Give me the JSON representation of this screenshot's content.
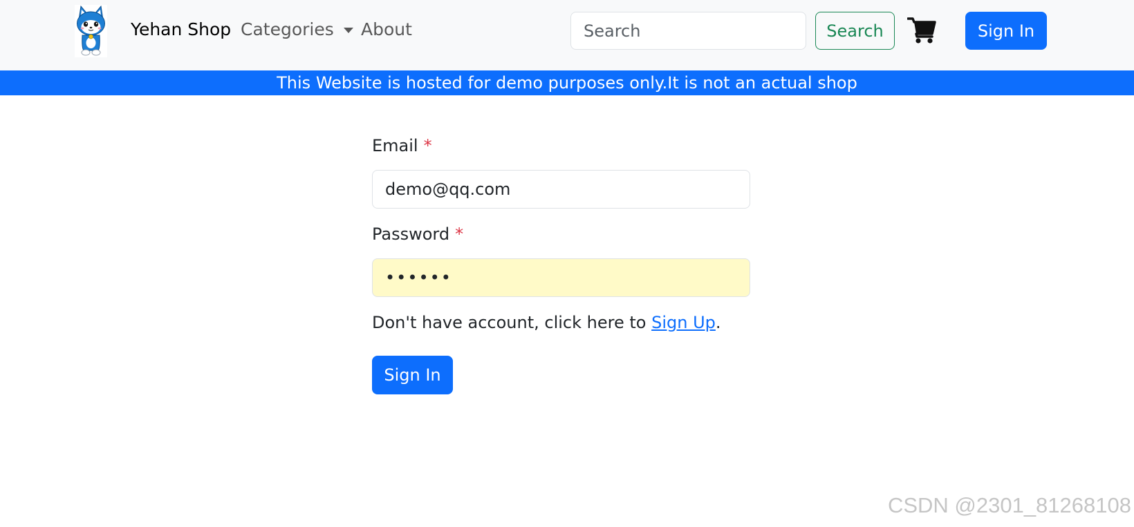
{
  "navbar": {
    "brand": "Yehan Shop",
    "categories_label": "Categories",
    "about_label": "About",
    "search_placeholder": "Search",
    "search_button": "Search",
    "signin_button": "Sign In",
    "cart_icon": "shopping-cart-icon",
    "logo_icon": "cat-mascot-logo"
  },
  "banner": {
    "text": "This Website is hosted for demo purposes only.It is not an actual shop"
  },
  "form": {
    "email_label": "Email",
    "email_required": "*",
    "email_value": "demo@qq.com",
    "password_label": "Password",
    "password_required": "*",
    "password_value": "••••••",
    "signup_prefix": "Don't have account, click here to ",
    "signup_link": "Sign Up",
    "signup_suffix": ".",
    "signin_button": "Sign In"
  },
  "watermark": "CSDN @2301_81268108",
  "colors": {
    "primary": "#0d6efd",
    "success": "#198754",
    "danger": "#dc3545",
    "navbar_bg": "#f8f9fa",
    "autofill_bg": "#fffac8"
  }
}
